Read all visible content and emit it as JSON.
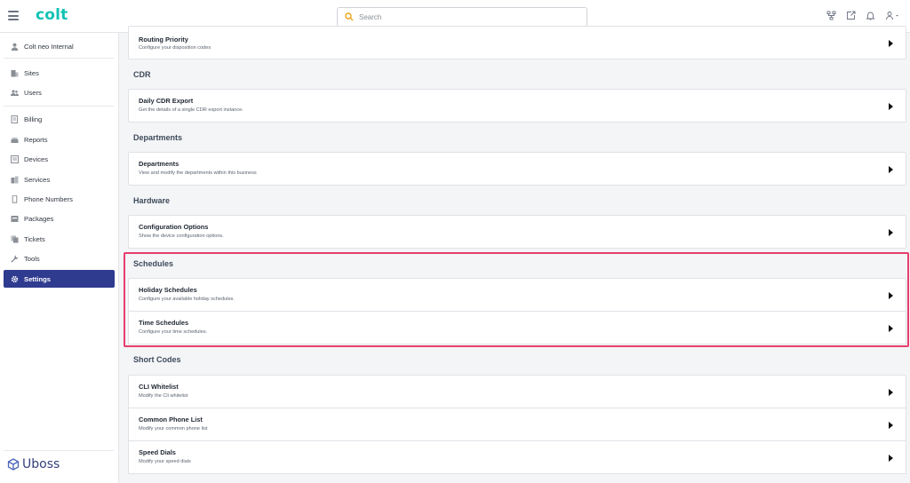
{
  "header": {
    "logo": "colt",
    "search_placeholder": "Search"
  },
  "sidebar": {
    "account": "Colt neo Internal",
    "items": [
      {
        "label": "Sites",
        "icon": "building-icon"
      },
      {
        "label": "Users",
        "icon": "users-icon"
      },
      {
        "label": "Billing",
        "icon": "billing-icon"
      },
      {
        "label": "Reports",
        "icon": "reports-icon"
      },
      {
        "label": "Devices",
        "icon": "devices-icon"
      },
      {
        "label": "Services",
        "icon": "services-icon"
      },
      {
        "label": "Phone Numbers",
        "icon": "phone-icon"
      },
      {
        "label": "Packages",
        "icon": "packages-icon"
      },
      {
        "label": "Tickets",
        "icon": "tickets-icon"
      },
      {
        "label": "Tools",
        "icon": "wrench-icon"
      },
      {
        "label": "Settings",
        "icon": "gear-icon"
      }
    ],
    "brand": "Uboss"
  },
  "main": {
    "routing": {
      "title": "Routing Priority",
      "desc": "Configure your disposition codes"
    },
    "sections": {
      "cdr": "CDR",
      "departments": "Departments",
      "hardware": "Hardware",
      "schedules": "Schedules",
      "short_codes": "Short Codes"
    },
    "cards": {
      "daily_cdr": {
        "title": "Daily CDR Export",
        "desc": "Get the details of a single CDR export instance."
      },
      "departments": {
        "title": "Departments",
        "desc": "View and modify the departments within this business"
      },
      "config_options": {
        "title": "Configuration Options",
        "desc": "Show the device configuration options."
      },
      "holiday": {
        "title": "Holiday Schedules",
        "desc": "Configure your available holiday schedules."
      },
      "time": {
        "title": "Time Schedules",
        "desc": "Configure your time schedules."
      },
      "cli": {
        "title": "CLI Whitelist",
        "desc": "Modify the Cli whitelist"
      },
      "common_phone": {
        "title": "Common Phone List",
        "desc": "Modify your common phone list"
      },
      "speed_dials": {
        "title": "Speed Dials",
        "desc": "Modify your speed dials"
      }
    }
  },
  "colors": {
    "accent": "#12c2b4",
    "active_nav": "#2e3b8f",
    "highlight_border": "#e83e6c"
  }
}
